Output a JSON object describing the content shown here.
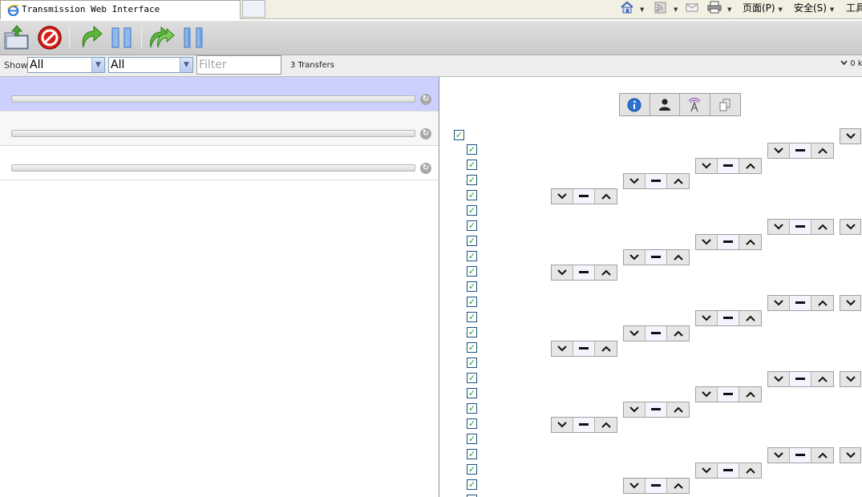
{
  "browser": {
    "tab_title": "Transmission Web Interface",
    "menu_page": "页面(P)",
    "menu_safety": "安全(S)",
    "menu_tools": "工具"
  },
  "toolbar": {
    "buttons": [
      "open-icon",
      "remove-icon",
      "resume-icon",
      "pause-icon",
      "resume-all-icon",
      "pause-all-icon"
    ]
  },
  "filterbar": {
    "show_label": "Show",
    "filter_state": "All",
    "filter_tracker": "All",
    "filter_placeholder": "Filter",
    "transfers": "3 Transfers",
    "speed": "0 k"
  },
  "torrents": [
    {
      "progress": 0,
      "selected": true
    },
    {
      "progress": 0,
      "selected": false
    },
    {
      "progress": 0,
      "selected": false
    }
  ],
  "inspector": {
    "tabs": [
      "info-icon",
      "peers-icon",
      "trackers-icon",
      "files-icon"
    ],
    "file_checkboxes_checked": 24
  },
  "colors": {
    "selected_row": "#cbd0ff",
    "check": "#21a121"
  }
}
